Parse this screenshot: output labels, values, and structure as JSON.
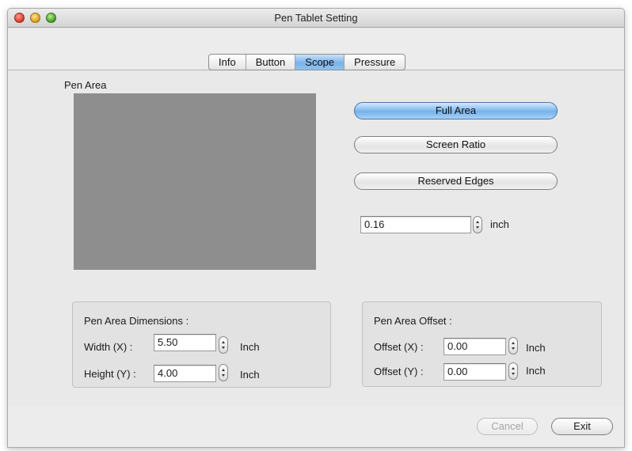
{
  "window": {
    "title": "Pen Tablet Setting"
  },
  "tabs": [
    {
      "label": "Info",
      "active": false
    },
    {
      "label": "Button",
      "active": false
    },
    {
      "label": "Scope",
      "active": true
    },
    {
      "label": "Pressure",
      "active": false
    }
  ],
  "pen_area": {
    "label": "Pen Area",
    "preview_color": "#8e8e8e"
  },
  "area_buttons": {
    "full_area": "Full Area",
    "screen_ratio": "Screen Ratio",
    "reserved_edges": "Reserved Edges"
  },
  "edge": {
    "value": "0.16",
    "unit": "inch"
  },
  "dimensions": {
    "title": "Pen Area Dimensions :",
    "width_label": "Width  (X) :",
    "width_value": "5.50",
    "height_label": "Height (Y) :",
    "height_value": "4.00",
    "unit": "Inch"
  },
  "offset": {
    "title": "Pen Area Offset :",
    "x_label": "Offset (X) :",
    "x_value": "0.00",
    "y_label": "Offset (Y) :",
    "y_value": "0.00",
    "unit": "Inch"
  },
  "footer": {
    "cancel": "Cancel",
    "exit": "Exit"
  },
  "colors": {
    "accent": "#76b2ec"
  }
}
